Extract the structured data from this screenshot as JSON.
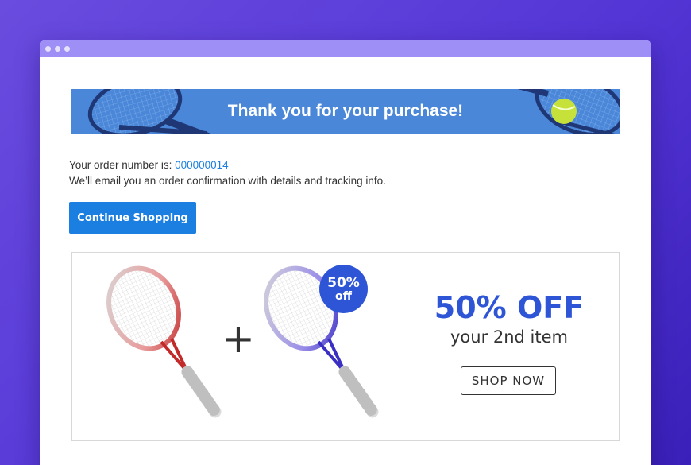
{
  "window": {
    "controls": [
      "close-dot",
      "minimize-dot",
      "maximize-dot"
    ]
  },
  "banner": {
    "text": "Thank you for your purchase!"
  },
  "order": {
    "prefix": "Your order number is: ",
    "number": "000000014",
    "email_note": "We’ll email you an order confirmation with details and tracking info."
  },
  "actions": {
    "continue_label": "Continue Shopping"
  },
  "promo": {
    "plus": "+",
    "badge_pct": "50%",
    "badge_off": "off",
    "headline": "50% OFF",
    "subline": "your 2nd item",
    "cta": "SHOP NOW",
    "colors": {
      "accent": "#2e55d6",
      "button": "#1a7fe0",
      "frame": "#9d8ff5"
    }
  }
}
